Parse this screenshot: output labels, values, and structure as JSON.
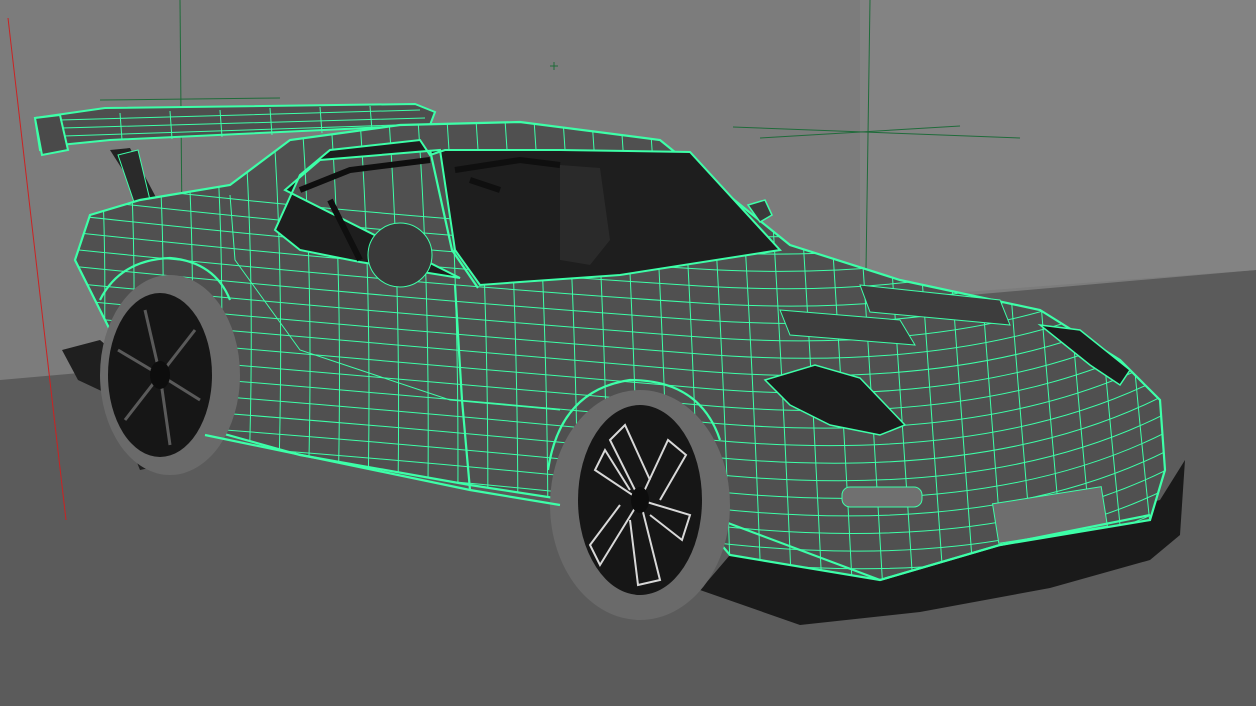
{
  "viewport": {
    "background_wall": "#7d7d7d",
    "background_floor": "#5c5c5c",
    "wireframe_color": "#3dffa8",
    "axis_x_color": "#cc2222",
    "axis_guide_color": "#1f6b3a",
    "model_shade_color": "#505050",
    "interior_color": "#1e1e1e"
  }
}
